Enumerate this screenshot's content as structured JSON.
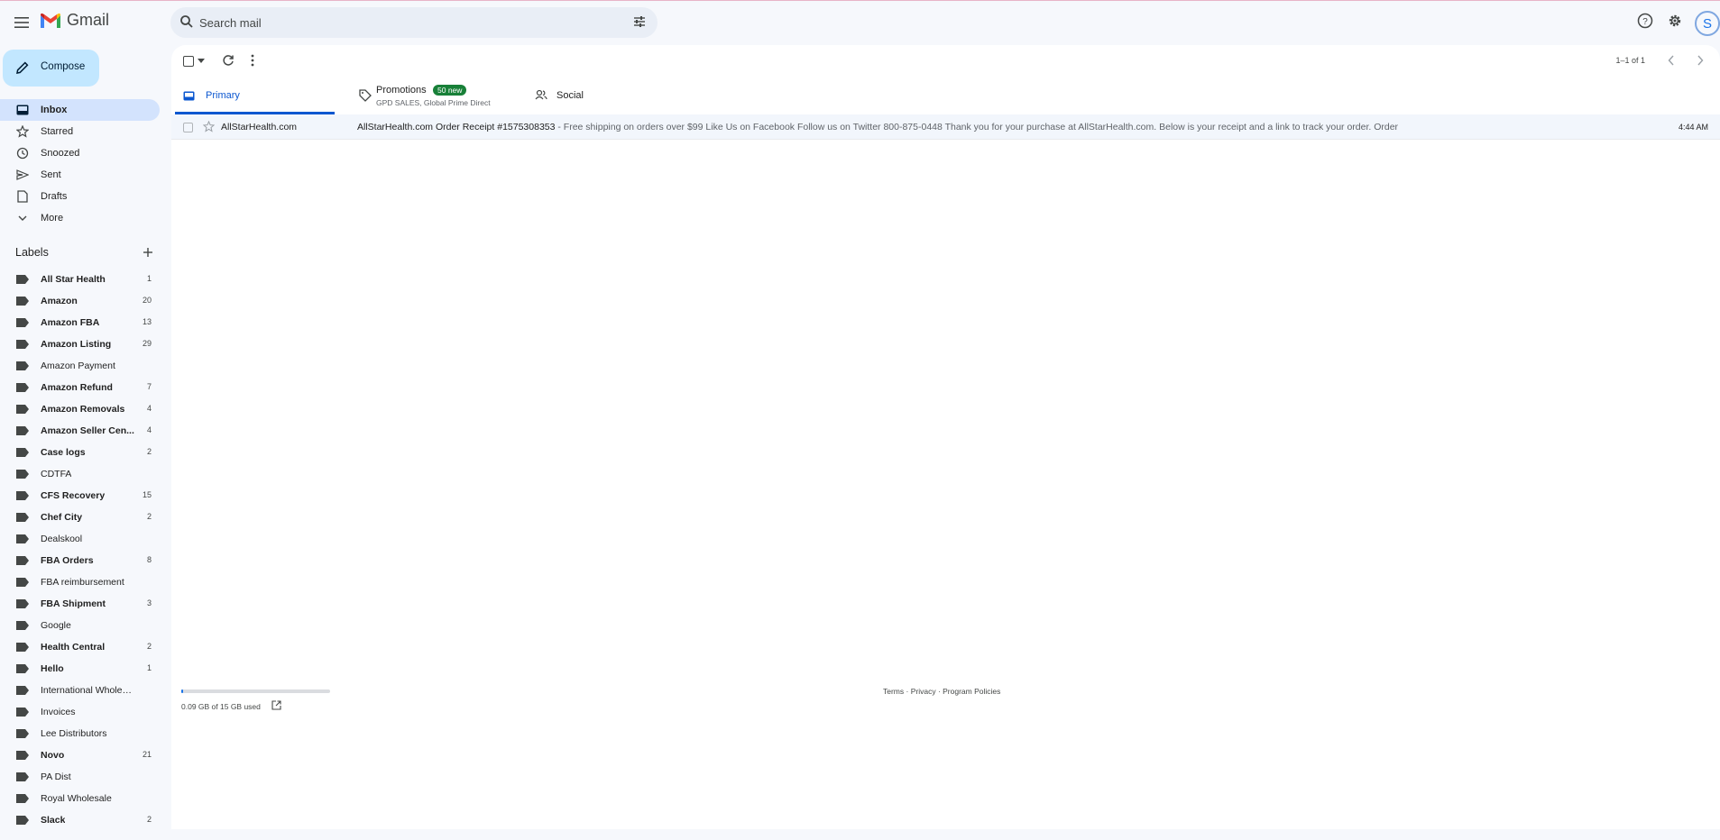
{
  "app": {
    "name": "Gmail"
  },
  "search": {
    "placeholder": "Search mail"
  },
  "account": {
    "avatar_letter": "S"
  },
  "compose": {
    "label": "Compose"
  },
  "nav": [
    {
      "label": "Inbox",
      "icon": "inbox-icon",
      "active": true
    },
    {
      "label": "Starred",
      "icon": "star-icon"
    },
    {
      "label": "Snoozed",
      "icon": "clock-icon"
    },
    {
      "label": "Sent",
      "icon": "send-icon"
    },
    {
      "label": "Drafts",
      "icon": "draft-icon"
    },
    {
      "label": "More",
      "icon": "chevron-down-icon"
    }
  ],
  "labels_section": {
    "title": "Labels"
  },
  "labels": [
    {
      "name": "All Star Health",
      "count": "1",
      "bold": true
    },
    {
      "name": "Amazon",
      "count": "20",
      "bold": true
    },
    {
      "name": "Amazon FBA",
      "count": "13",
      "bold": true
    },
    {
      "name": "Amazon Listing",
      "count": "29",
      "bold": true
    },
    {
      "name": "Amazon Payment",
      "count": "",
      "bold": false
    },
    {
      "name": "Amazon Refund",
      "count": "7",
      "bold": true
    },
    {
      "name": "Amazon Removals",
      "count": "4",
      "bold": true
    },
    {
      "name": "Amazon Seller Cen...",
      "count": "4",
      "bold": true
    },
    {
      "name": "Case logs",
      "count": "2",
      "bold": true
    },
    {
      "name": "CDTFA",
      "count": "",
      "bold": false
    },
    {
      "name": "CFS Recovery",
      "count": "15",
      "bold": true
    },
    {
      "name": "Chef City",
      "count": "2",
      "bold": true
    },
    {
      "name": "Dealskool",
      "count": "",
      "bold": false
    },
    {
      "name": "FBA Orders",
      "count": "8",
      "bold": true
    },
    {
      "name": "FBA reimbursement",
      "count": "",
      "bold": false
    },
    {
      "name": "FBA Shipment",
      "count": "3",
      "bold": true
    },
    {
      "name": "Google",
      "count": "",
      "bold": false
    },
    {
      "name": "Health Central",
      "count": "2",
      "bold": true
    },
    {
      "name": "Hello",
      "count": "1",
      "bold": true
    },
    {
      "name": "International Wholesale",
      "count": "",
      "bold": false
    },
    {
      "name": "Invoices",
      "count": "",
      "bold": false
    },
    {
      "name": "Lee Distributors",
      "count": "",
      "bold": false
    },
    {
      "name": "Novo",
      "count": "21",
      "bold": true
    },
    {
      "name": "PA Dist",
      "count": "",
      "bold": false
    },
    {
      "name": "Royal Wholesale",
      "count": "",
      "bold": false
    },
    {
      "name": "Slack",
      "count": "2",
      "bold": true
    }
  ],
  "toolbar": {
    "pager": "1–1 of 1"
  },
  "tabs": {
    "primary": "Primary",
    "promotions": "Promotions",
    "promotions_badge": "50 new",
    "promotions_sub": "GPD SALES, Global Prime Direct",
    "social": "Social"
  },
  "emails": [
    {
      "sender": "AllStarHealth.com",
      "subject": "AllStarHealth.com Order Receipt #1575308353",
      "preview": " - Free shipping on orders over $99 Like Us on Facebook Follow us on Twitter 800-875-0448 Thank you for your purchase at AllStarHealth.com. Below is your receipt and a link to track your order. Order",
      "time": "4:44 AM"
    }
  ],
  "storage": {
    "text": "0.09 GB of 15 GB used",
    "used_fraction": 0.006
  },
  "footer": {
    "terms": "Terms",
    "privacy": "Privacy",
    "policies": "Program Policies",
    "sep": " · "
  },
  "colors": {
    "accent": "#0b57d0",
    "compose_bg": "#c2e7ff",
    "active_nav": "#d3e3fd",
    "badge": "#188038"
  }
}
